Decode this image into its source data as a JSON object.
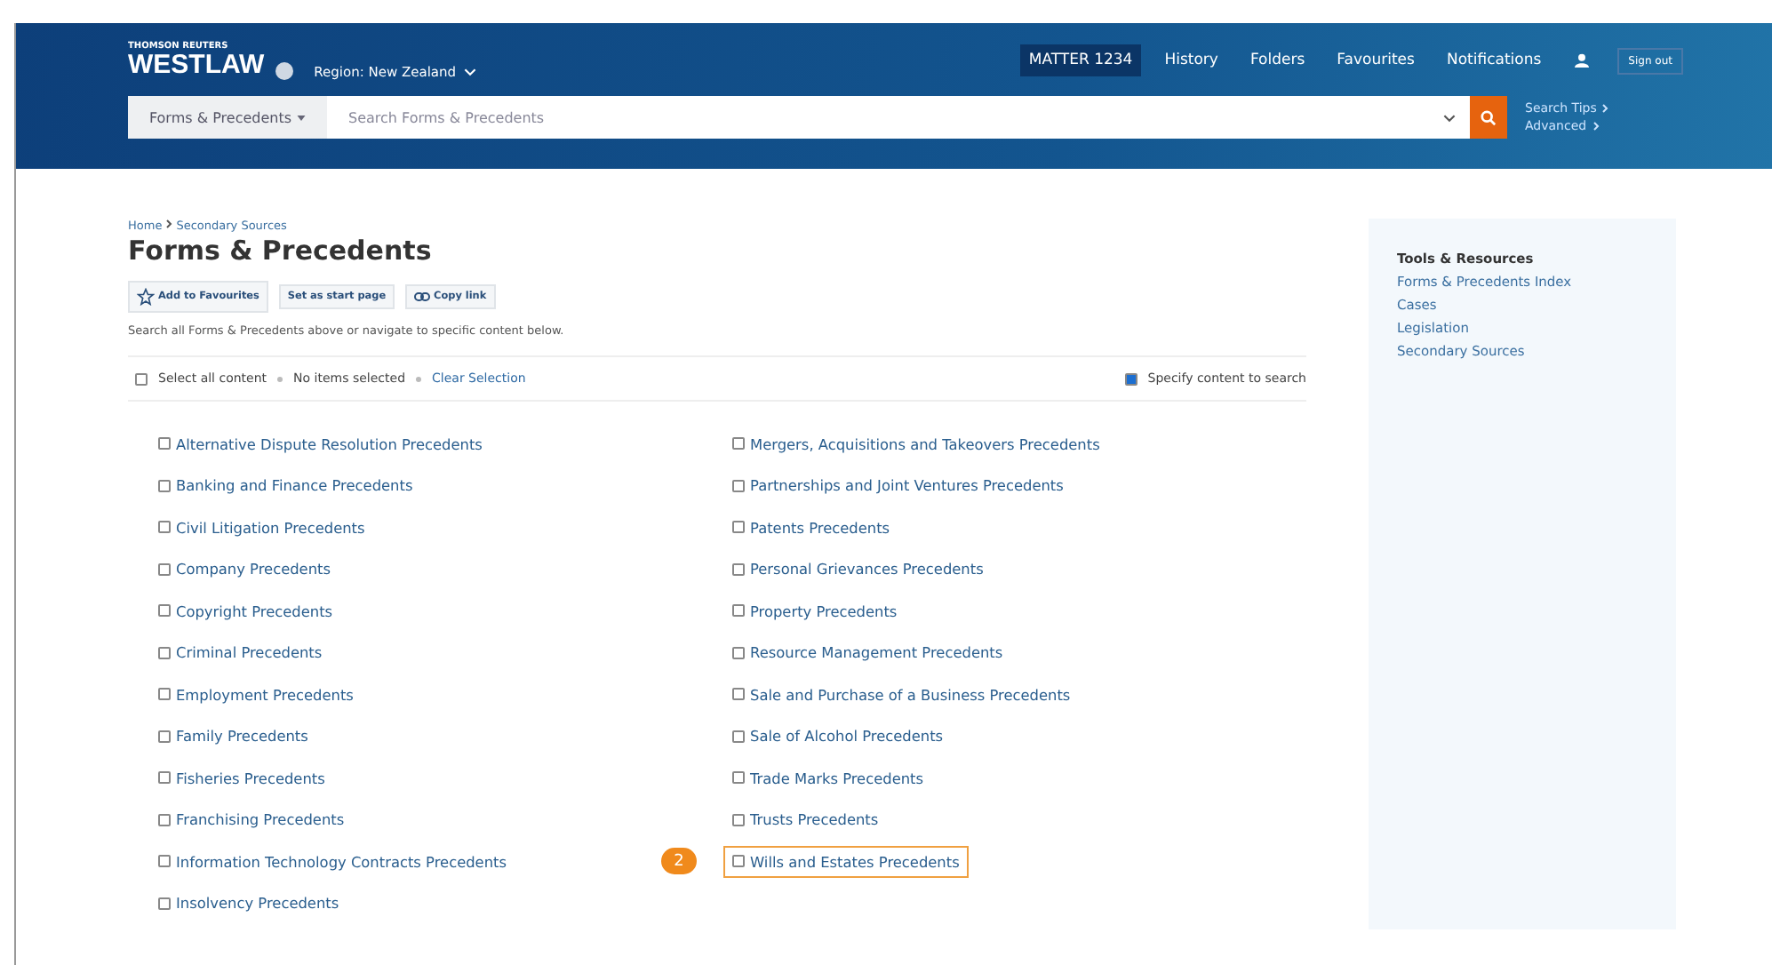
{
  "header": {
    "brand_top": "THOMSON REUTERS",
    "brand": "WESTLAW",
    "region": "Region: New Zealand",
    "nav": [
      {
        "label": "MATTER 1234",
        "selected": true
      },
      {
        "label": "History",
        "selected": false
      },
      {
        "label": "Folders",
        "selected": false
      },
      {
        "label": "Favourites",
        "selected": false
      },
      {
        "label": "Notifications",
        "selected": false
      }
    ],
    "sign_out": "Sign out",
    "scope": "Forms & Precedents",
    "search": {
      "placeholder": "Search Forms & Precedents"
    },
    "links": [
      "Search Tips",
      "Advanced"
    ]
  },
  "breadcrumb": [
    "Home",
    "Secondary Sources"
  ],
  "title": "Forms & Precedents",
  "actions": [
    {
      "kind": "star",
      "label": "Add to Favourites"
    },
    {
      "kind": "plain",
      "label": "Set as start page"
    },
    {
      "kind": "link",
      "label": "Copy link"
    }
  ],
  "description": "Search all Forms & Precedents above or navigate to specific content below.",
  "selection": {
    "select_all": {
      "label": "Select all content",
      "checked": false
    },
    "status": "No items selected",
    "clear": "Clear Selection",
    "specify": {
      "label": "Specify content to search",
      "checked": true
    }
  },
  "columns": [
    [
      {
        "label": "Alternative Dispute Resolution Precedents",
        "checked": false
      },
      {
        "label": "Banking and Finance Precedents",
        "checked": false
      },
      {
        "label": "Civil Litigation Precedents",
        "checked": false
      },
      {
        "label": "Company Precedents",
        "checked": false
      },
      {
        "label": "Copyright Precedents",
        "checked": false
      },
      {
        "label": "Criminal Precedents",
        "checked": false
      },
      {
        "label": "Employment Precedents",
        "checked": false
      },
      {
        "label": "Family Precedents",
        "checked": false
      },
      {
        "label": "Fisheries Precedents",
        "checked": false
      },
      {
        "label": "Franchising Precedents",
        "checked": false
      },
      {
        "label": "Information Technology Contracts Precedents",
        "checked": false
      },
      {
        "label": "Insolvency Precedents",
        "checked": false
      }
    ],
    [
      {
        "label": "Mergers, Acquisitions and Takeovers Precedents",
        "checked": false
      },
      {
        "label": "Partnerships and Joint Ventures Precedents",
        "checked": false
      },
      {
        "label": "Patents Precedents",
        "checked": false
      },
      {
        "label": "Personal Grievances Precedents",
        "checked": false
      },
      {
        "label": "Property Precedents",
        "checked": false
      },
      {
        "label": "Resource Management Precedents",
        "checked": false
      },
      {
        "label": "Sale and Purchase of a Business Precedents",
        "checked": false
      },
      {
        "label": "Sale of Alcohol Precedents",
        "checked": false
      },
      {
        "label": "Trade Marks Precedents",
        "checked": false
      },
      {
        "label": "Trusts Precedents",
        "checked": false
      },
      {
        "label": "Wills and Estates Precedents",
        "checked": false,
        "callout": "2"
      }
    ]
  ],
  "sidebar": {
    "title": "Tools & Resources",
    "items": [
      "Forms & Precedents Index",
      "Cases",
      "Legislation",
      "Secondary Sources"
    ]
  }
}
